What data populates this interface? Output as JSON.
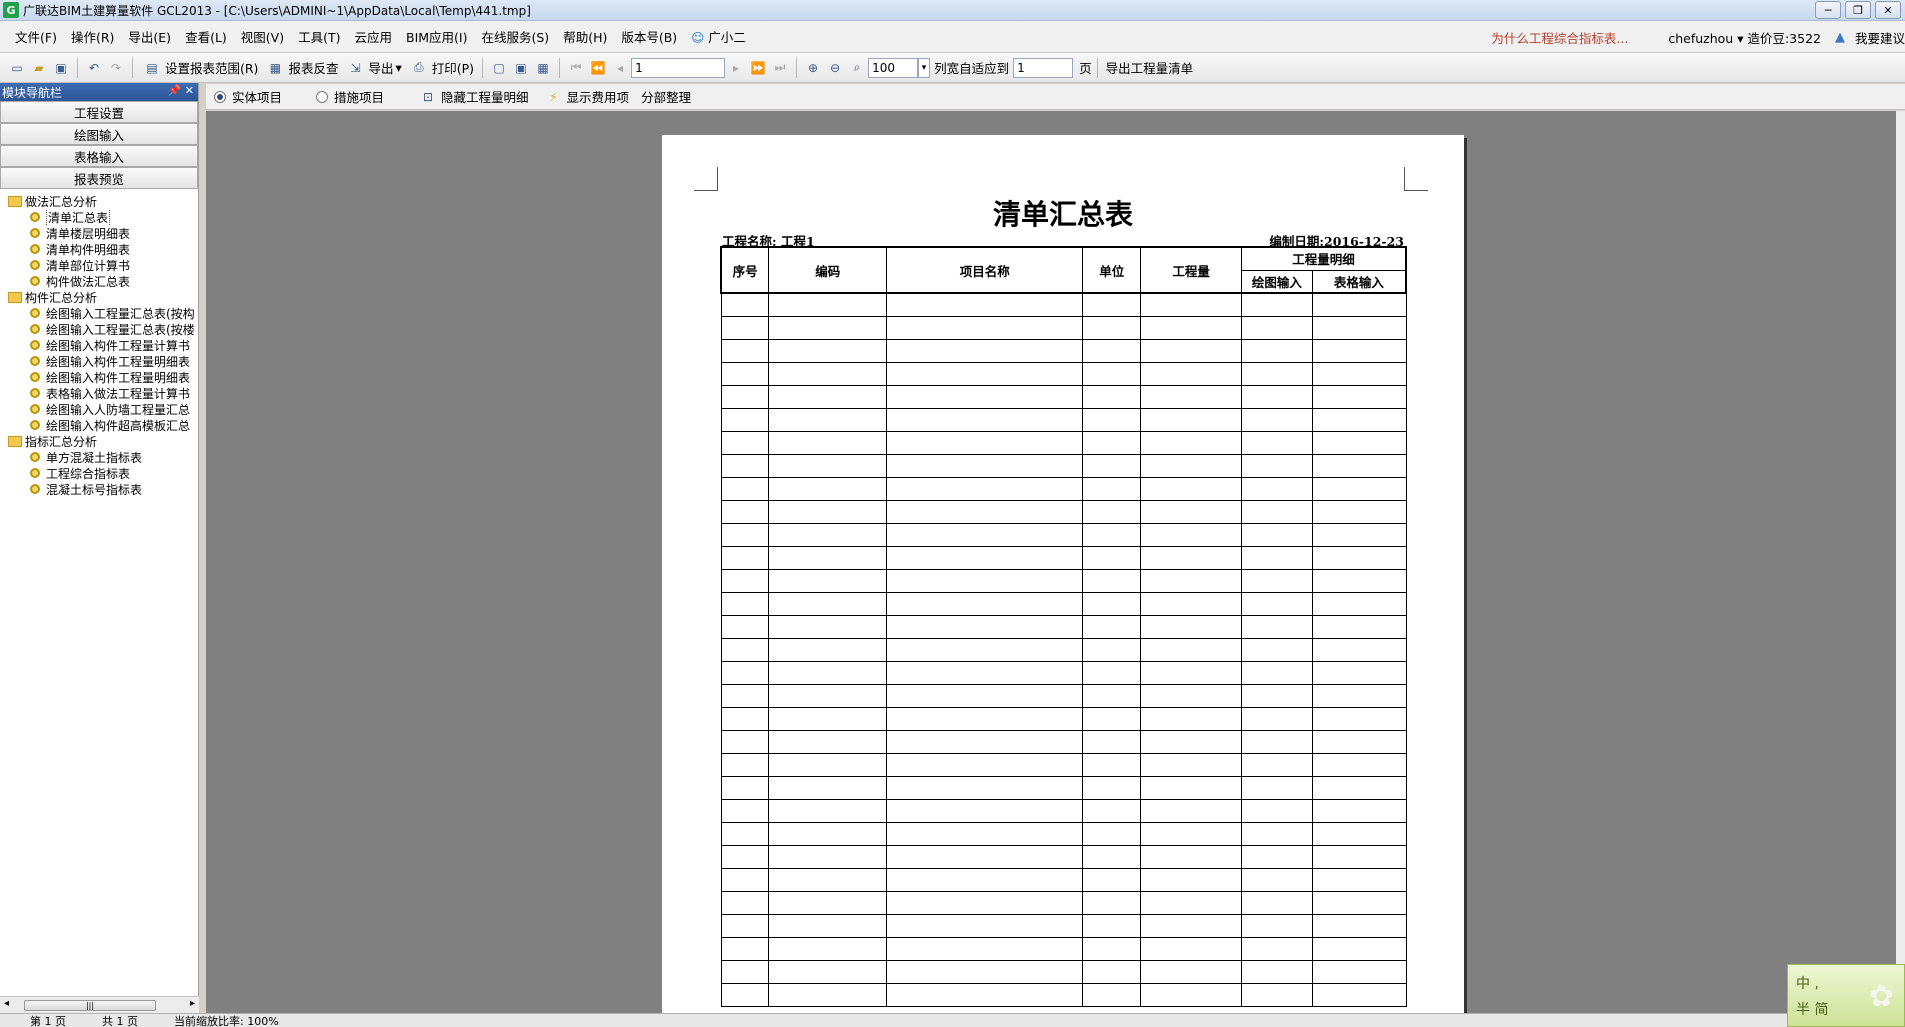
{
  "window": {
    "title": "广联达BIM土建算量软件 GCL2013 - [C:\\Users\\ADMINI~1\\AppData\\Local\\Temp\\441.tmp]"
  },
  "menu": {
    "items": [
      "文件(F)",
      "操作(R)",
      "导出(E)",
      "查看(L)",
      "视图(V)",
      "工具(T)",
      "云应用",
      "BIM应用(I)",
      "在线服务(S)",
      "帮助(H)",
      "版本号(B)",
      "广小二"
    ],
    "question": "为什么工程综合指标表...",
    "user": "chefuzhou",
    "balance": "造价豆:3522",
    "extra": "我要建议"
  },
  "toolbar": {
    "set_range": "设置报表范围(R)",
    "report_check": "报表反查",
    "export": "导出",
    "print": "打印(P)",
    "page_value": "1",
    "zoom_value": "100",
    "fit_label": "列宽自适应到",
    "fit_value": "1",
    "page_unit": "页",
    "export_list": "导出工程量清单"
  },
  "toolbar2": {
    "radio_entity": "实体项目",
    "radio_measure": "措施项目",
    "hide_detail": "隐藏工程量明细",
    "show_fee": "显示费用项",
    "section_sort": "分部整理"
  },
  "nav": {
    "header": "模块导航栏",
    "buttons": [
      "工程设置",
      "绘图输入",
      "表格输入",
      "报表预览"
    ],
    "groups": [
      {
        "label": "做法汇总分析",
        "items": [
          "清单汇总表",
          "清单楼层明细表",
          "清单构件明细表",
          "清单部位计算书",
          "构件做法汇总表"
        ]
      },
      {
        "label": "构件汇总分析",
        "items": [
          "绘图输入工程量汇总表(按构",
          "绘图输入工程量汇总表(按楼",
          "绘图输入构件工程量计算书",
          "绘图输入构件工程量明细表",
          "绘图输入构件工程量明细表",
          "表格输入做法工程量计算书",
          "绘图输入人防墙工程量汇总",
          "绘图输入构件超高模板汇总"
        ]
      },
      {
        "label": "指标汇总分析",
        "items": [
          "单方混凝土指标表",
          "工程综合指标表",
          "混凝土标号指标表"
        ]
      }
    ]
  },
  "report": {
    "title": "清单汇总表",
    "project_label": "工程名称: 工程1",
    "date_label": "编制日期:2016-12-23",
    "headers": {
      "seq": "序号",
      "code": "编码",
      "name": "项目名称",
      "unit": "单位",
      "qty": "工程量",
      "detail": "工程量明细",
      "draw": "绘图输入",
      "table": "表格输入"
    }
  },
  "status": {
    "page": "第 1 页",
    "total": "共 1 页",
    "zoom": "当前缩放比率: 100%"
  },
  "ime": {
    "line1": "中 ,",
    "line2": "半 简"
  },
  "colors": {
    "nav_header": "#2b5597",
    "annotation_line": "#e0242a",
    "viewer_bg": "#808080"
  }
}
